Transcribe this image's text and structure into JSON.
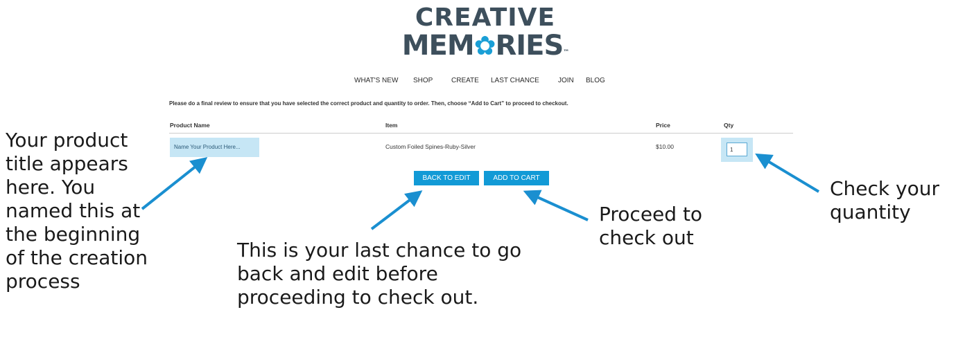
{
  "logo": {
    "line1": "CREATIVE",
    "line2_a": "MEM",
    "line2_b": "RIES",
    "flower": "✿",
    "tm": "™",
    "flower_icon": "flower-icon"
  },
  "nav": {
    "items": [
      "WHAT'S NEW",
      "SHOP",
      "CREATE",
      "LAST CHANCE",
      "JOIN",
      "BLOG"
    ]
  },
  "instructions": "Please do a final review to ensure that you have selected the correct product and quantity to order. Then, choose “Add to Cart” to proceed to checkout.",
  "table": {
    "headers": {
      "product_name": "Product Name",
      "item": "Item",
      "price": "Price",
      "qty": "Qty"
    },
    "row": {
      "product_name": "Name Your Product Here...",
      "item": "Custom Foiled Spines-Ruby-Silver",
      "price": "$10.00",
      "qty": "1"
    }
  },
  "buttons": {
    "back_to_edit": "BACK TO EDIT",
    "add_to_cart": "ADD TO CART"
  },
  "annotations": {
    "product_title": "Your product title appears here. You named this at the beginning of the creation process",
    "last_chance": "This is your last chance to go back and edit before proceeding to check out.",
    "proceed": "Proceed to check out",
    "quantity": "Check your quantity"
  },
  "colors": {
    "accent": "#129ad6",
    "highlight": "#c6e6f5",
    "logo_text": "#3d4f5c",
    "arrow": "#1a8fd0"
  }
}
